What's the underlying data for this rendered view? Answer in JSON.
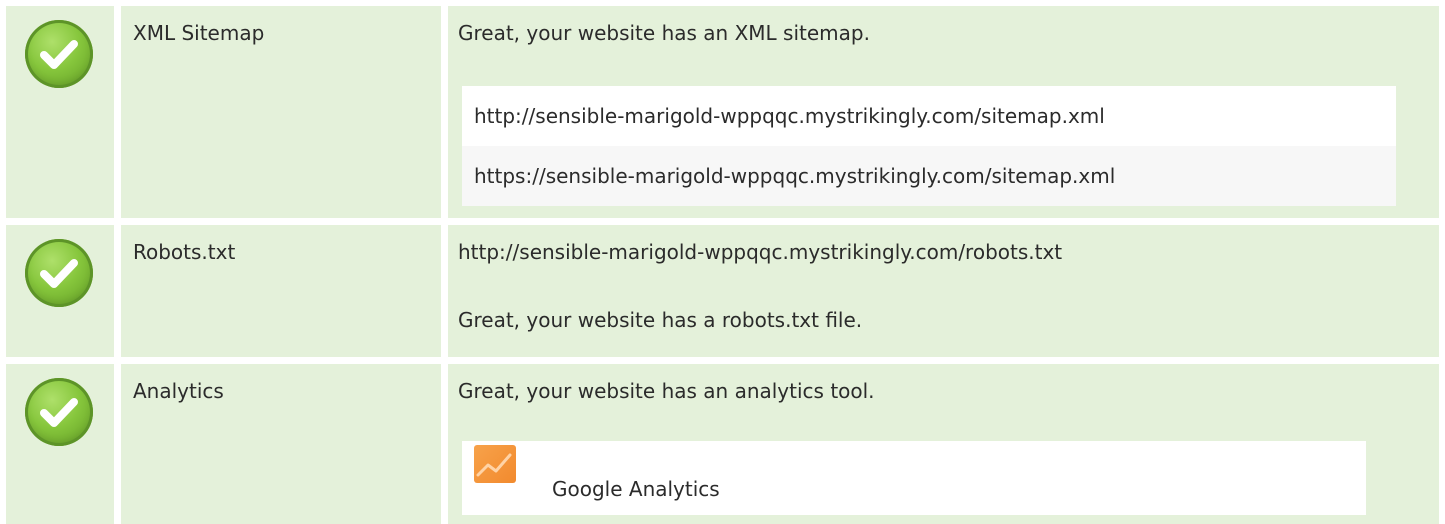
{
  "rows": [
    {
      "name": "XML Sitemap",
      "status": "passed",
      "message": "Great, your website has an XML sitemap.",
      "urls": [
        "http://sensible-marigold-wppqqc.mystrikingly.com/sitemap.xml",
        "https://sensible-marigold-wppqqc.mystrikingly.com/sitemap.xml"
      ]
    },
    {
      "name": "Robots.txt",
      "status": "passed",
      "url": "http://sensible-marigold-wppqqc.mystrikingly.com/robots.txt",
      "message": "Great, your website has a robots.txt file."
    },
    {
      "name": "Analytics",
      "status": "passed",
      "message": "Great, your website has an analytics tool.",
      "tools": [
        {
          "name": "Google Analytics",
          "icon": "google-analytics-icon"
        }
      ]
    }
  ],
  "colors": {
    "row_background": "#e4f1da",
    "check_green": "#86c63c",
    "analytics_orange": "#f28a2e"
  }
}
